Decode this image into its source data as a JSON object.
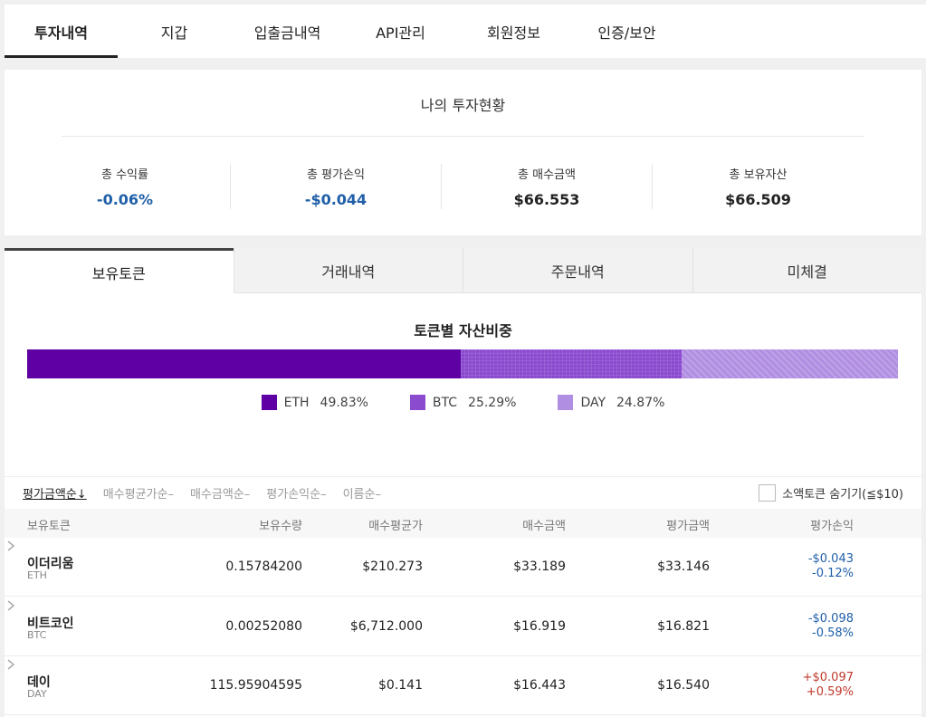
{
  "top_tabs": [
    "투자내역",
    "지갑",
    "입출금내역",
    "API관리",
    "회원정보",
    "인증/보안"
  ],
  "summary": {
    "title": "나의 투자현황",
    "stats": [
      {
        "label": "총 수익률",
        "value": "-0.06%"
      },
      {
        "label": "총 평가손익",
        "value": "-$0.044"
      },
      {
        "label": "총 매수금액",
        "value": "$66.553"
      },
      {
        "label": "총 보유자산",
        "value": "$66.509"
      }
    ]
  },
  "sub_tabs": [
    "보유토큰",
    "거래내역",
    "주문내역",
    "미체결"
  ],
  "allocation": {
    "title": "토큰별 자산비중",
    "items": [
      {
        "name": "ETH",
        "percent_label": "49.83%",
        "percent": 49.83,
        "color": "#5e00a4"
      },
      {
        "name": "BTC",
        "percent_label": "25.29%",
        "percent": 25.29,
        "color": "#8a4bcf"
      },
      {
        "name": "DAY",
        "percent_label": "24.87%",
        "percent": 24.87,
        "color": "#b08ee2"
      }
    ]
  },
  "sort_options": [
    "평가금액순↓",
    "매수평균가순–",
    "매수금액순–",
    "평가손익순–",
    "이름순–"
  ],
  "hide_small_label": "소액토큰 숨기기(≦$10)",
  "table": {
    "headers": [
      "보유토큰",
      "보유수량",
      "매수평균가",
      "매수금액",
      "평가금액",
      "평가손익"
    ],
    "rows": [
      {
        "name": "이더리움",
        "symbol": "ETH",
        "quantity": "0.15784200",
        "avg_price": "$210.273",
        "buy_amount": "$33.189",
        "eval_amount": "$33.146",
        "pl_amount": "-$0.043",
        "pl_rate": "-0.12%"
      },
      {
        "name": "비트코인",
        "symbol": "BTC",
        "quantity": "0.00252080",
        "avg_price": "$6,712.000",
        "buy_amount": "$16.919",
        "eval_amount": "$16.821",
        "pl_amount": "-$0.098",
        "pl_rate": "-0.58%"
      },
      {
        "name": "데이",
        "symbol": "DAY",
        "quantity": "115.95904595",
        "avg_price": "$0.141",
        "buy_amount": "$16.443",
        "eval_amount": "$16.540",
        "pl_amount": "+$0.097",
        "pl_rate": "+0.59%"
      }
    ]
  },
  "colors": {
    "negative": "#1f5fa8",
    "positive": "#c0392b"
  }
}
